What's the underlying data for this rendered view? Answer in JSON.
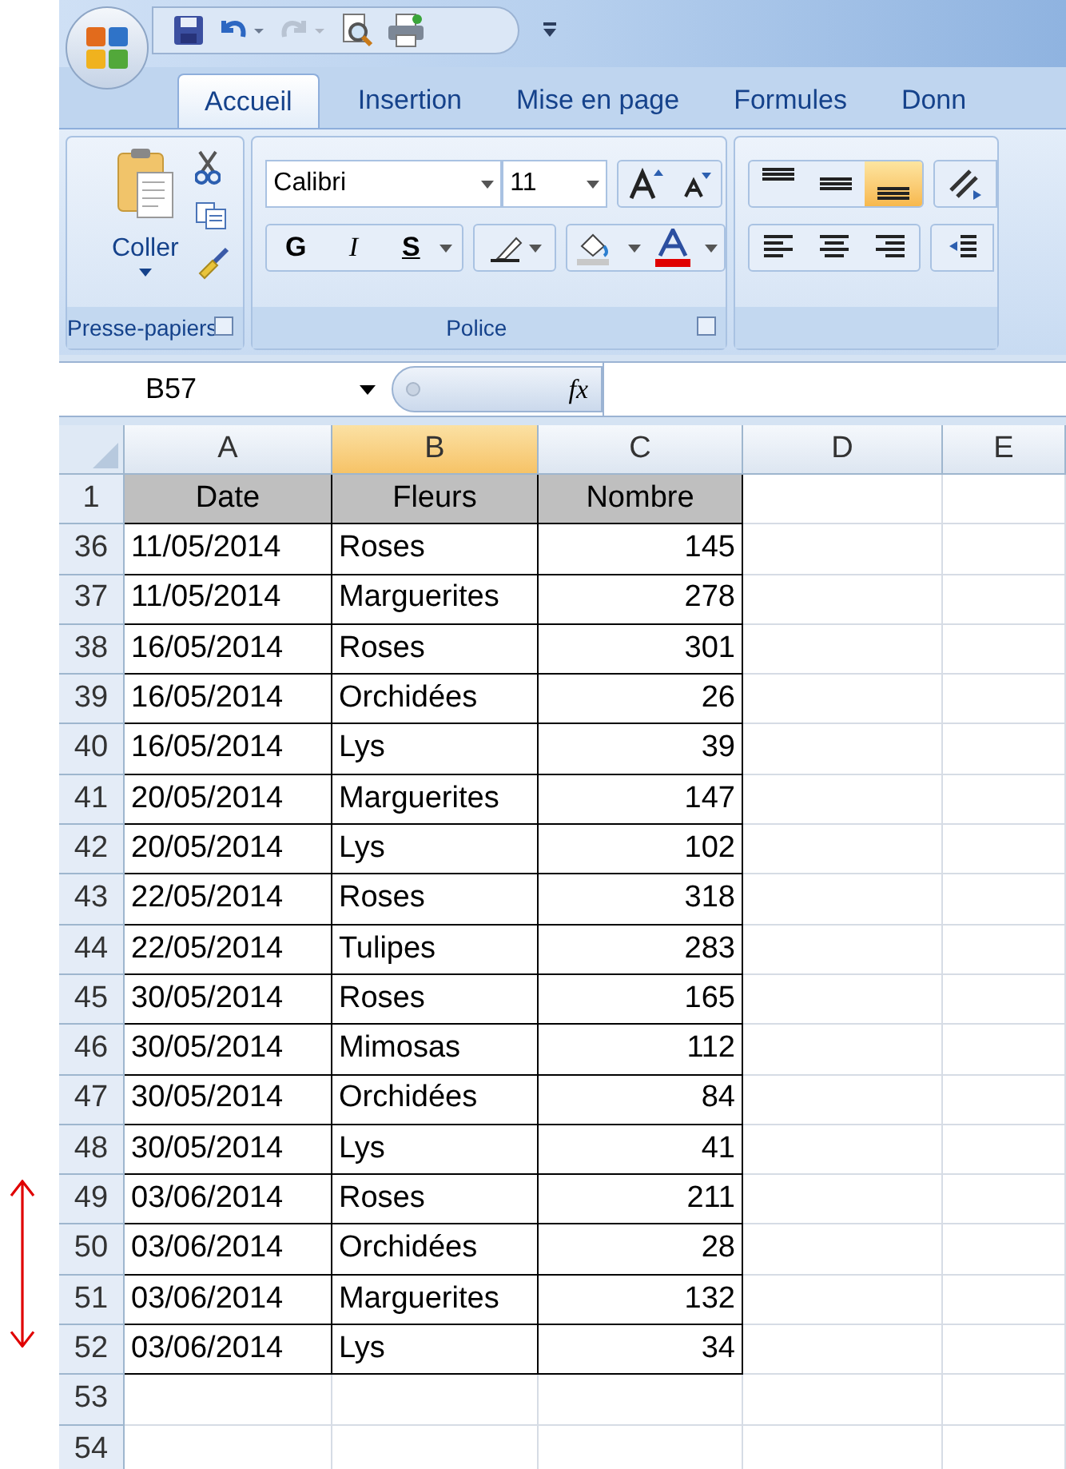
{
  "tabs": [
    {
      "label": "Accueil",
      "selected": true
    },
    {
      "label": "Insertion",
      "selected": false
    },
    {
      "label": "Mise en page",
      "selected": false
    },
    {
      "label": "Formules",
      "selected": false
    },
    {
      "label": "Donn",
      "selected": false
    }
  ],
  "ribbon": {
    "clipboard": {
      "paste_label": "Coller",
      "title": "Presse-papiers"
    },
    "font": {
      "font_name": "Calibri",
      "font_size": "11",
      "style_buttons": [
        "G",
        "I",
        "S"
      ],
      "title": "Police"
    },
    "alignment": {
      "buttons": [
        {
          "kind": "align-top",
          "selected": false
        },
        {
          "kind": "align-middle",
          "selected": false
        },
        {
          "kind": "align-bottom",
          "selected": true
        }
      ]
    }
  },
  "formula_bar": {
    "name_box": "B57",
    "function_label": "fx"
  },
  "sheet": {
    "columns": [
      {
        "label": "A",
        "selected": false
      },
      {
        "label": "B",
        "selected": true
      },
      {
        "label": "C",
        "selected": false
      },
      {
        "label": "D",
        "selected": false
      },
      {
        "label": "E",
        "selected": false
      }
    ],
    "rows": [
      {
        "number": "1",
        "kind": "header",
        "marked": false,
        "cells": [
          "Date",
          "Fleurs",
          "Nombre"
        ]
      },
      {
        "number": "36",
        "kind": "data",
        "marked": false,
        "cells": [
          "11/05/2014",
          "Roses",
          "145"
        ]
      },
      {
        "number": "37",
        "kind": "data",
        "marked": false,
        "cells": [
          "11/05/2014",
          "Marguerites",
          "278"
        ]
      },
      {
        "number": "38",
        "kind": "data",
        "marked": false,
        "cells": [
          "16/05/2014",
          "Roses",
          "301"
        ]
      },
      {
        "number": "39",
        "kind": "data",
        "marked": false,
        "cells": [
          "16/05/2014",
          "Orchidées",
          "26"
        ]
      },
      {
        "number": "40",
        "kind": "data",
        "marked": false,
        "cells": [
          "16/05/2014",
          "Lys",
          "39"
        ]
      },
      {
        "number": "41",
        "kind": "data",
        "marked": false,
        "cells": [
          "20/05/2014",
          "Marguerites",
          "147"
        ]
      },
      {
        "number": "42",
        "kind": "data",
        "marked": false,
        "cells": [
          "20/05/2014",
          "Lys",
          "102"
        ]
      },
      {
        "number": "43",
        "kind": "data",
        "marked": false,
        "cells": [
          "22/05/2014",
          "Roses",
          "318"
        ]
      },
      {
        "number": "44",
        "kind": "data",
        "marked": false,
        "cells": [
          "22/05/2014",
          "Tulipes",
          "283"
        ]
      },
      {
        "number": "45",
        "kind": "data",
        "marked": false,
        "cells": [
          "30/05/2014",
          "Roses",
          "165"
        ]
      },
      {
        "number": "46",
        "kind": "data",
        "marked": false,
        "cells": [
          "30/05/2014",
          "Mimosas",
          "112"
        ]
      },
      {
        "number": "47",
        "kind": "data",
        "marked": false,
        "cells": [
          "30/05/2014",
          "Orchidées",
          "84"
        ]
      },
      {
        "number": "48",
        "kind": "data",
        "marked": false,
        "cells": [
          "30/05/2014",
          "Lys",
          "41"
        ]
      },
      {
        "number": "49",
        "kind": "data",
        "marked": true,
        "cells": [
          "03/06/2014",
          "Roses",
          "211"
        ]
      },
      {
        "number": "50",
        "kind": "data",
        "marked": true,
        "cells": [
          "03/06/2014",
          "Orchidées",
          "28"
        ]
      },
      {
        "number": "51",
        "kind": "data",
        "marked": true,
        "cells": [
          "03/06/2014",
          "Marguerites",
          "132"
        ]
      },
      {
        "number": "52",
        "kind": "data",
        "marked": true,
        "cells": [
          "03/06/2014",
          "Lys",
          "34"
        ]
      },
      {
        "number": "53",
        "kind": "empty",
        "marked": false,
        "cells": []
      },
      {
        "number": "54",
        "kind": "empty",
        "marked": false,
        "cells": []
      }
    ]
  }
}
